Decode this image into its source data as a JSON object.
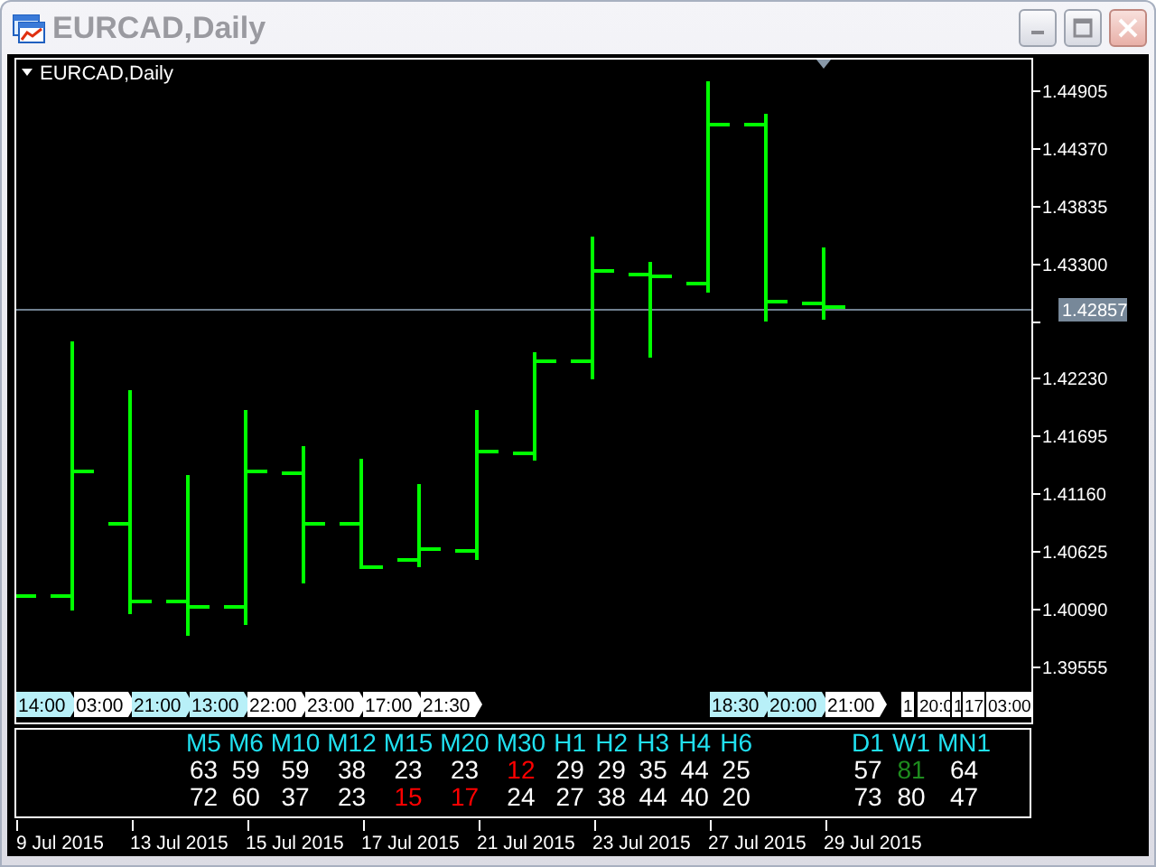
{
  "window": {
    "title": "EURCAD,Daily"
  },
  "chart": {
    "title": "EURCAD,Daily",
    "price_labels": [
      "1.44905",
      "1.44370",
      "1.43835",
      "1.43300",
      "1.42230",
      "1.41695",
      "1.41160",
      "1.40625",
      "1.40090",
      "1.39555"
    ],
    "current_price": "1.42857",
    "time_labels": [
      {
        "text": "14:00",
        "highlighted": true
      },
      {
        "text": "03:00",
        "highlighted": false
      },
      {
        "text": "21:00",
        "highlighted": true
      },
      {
        "text": "13:00",
        "highlighted": true
      },
      {
        "text": "22:00",
        "highlighted": false
      },
      {
        "text": "23:00",
        "highlighted": false
      },
      {
        "text": "17:00",
        "highlighted": false
      },
      {
        "text": "21:30",
        "highlighted": false
      },
      {
        "text": "18:30",
        "highlighted": true
      },
      {
        "text": "20:00",
        "highlighted": true
      },
      {
        "text": "21:00",
        "highlighted": false
      },
      {
        "text": "1",
        "highlighted": false
      },
      {
        "text": "20:0",
        "highlighted": false
      },
      {
        "text": "1",
        "highlighted": false
      },
      {
        "text": "17",
        "highlighted": false
      },
      {
        "text": "03:00",
        "highlighted": false
      }
    ]
  },
  "indicator": {
    "groups": [
      {
        "columns": [
          {
            "label": "M5",
            "values": [
              {
                "text": "63",
                "color": "#ffffff"
              },
              {
                "text": "72",
                "color": "#ffffff"
              }
            ]
          },
          {
            "label": "M6",
            "values": [
              {
                "text": "59",
                "color": "#ffffff"
              },
              {
                "text": "60",
                "color": "#ffffff"
              }
            ]
          },
          {
            "label": "M10",
            "values": [
              {
                "text": "59",
                "color": "#ffffff"
              },
              {
                "text": "37",
                "color": "#ffffff"
              }
            ]
          },
          {
            "label": "M12",
            "values": [
              {
                "text": "38",
                "color": "#ffffff"
              },
              {
                "text": "23",
                "color": "#ffffff"
              }
            ]
          },
          {
            "label": "M15",
            "values": [
              {
                "text": "23",
                "color": "#ffffff"
              },
              {
                "text": "15",
                "color": "#ff0000"
              }
            ]
          },
          {
            "label": "M20",
            "values": [
              {
                "text": "23",
                "color": "#ffffff"
              },
              {
                "text": "17",
                "color": "#ff0000"
              }
            ]
          },
          {
            "label": "M30",
            "values": [
              {
                "text": "12",
                "color": "#ff0000"
              },
              {
                "text": "24",
                "color": "#ffffff"
              }
            ]
          },
          {
            "label": "H1",
            "values": [
              {
                "text": "29",
                "color": "#ffffff"
              },
              {
                "text": "27",
                "color": "#ffffff"
              }
            ]
          },
          {
            "label": "H2",
            "values": [
              {
                "text": "29",
                "color": "#ffffff"
              },
              {
                "text": "38",
                "color": "#ffffff"
              }
            ]
          },
          {
            "label": "H3",
            "values": [
              {
                "text": "35",
                "color": "#ffffff"
              },
              {
                "text": "44",
                "color": "#ffffff"
              }
            ]
          },
          {
            "label": "H4",
            "values": [
              {
                "text": "44",
                "color": "#ffffff"
              },
              {
                "text": "40",
                "color": "#ffffff"
              }
            ]
          },
          {
            "label": "H6",
            "values": [
              {
                "text": "25",
                "color": "#ffffff"
              },
              {
                "text": "20",
                "color": "#ffffff"
              }
            ]
          }
        ]
      },
      {
        "columns": [
          {
            "label": "D1",
            "values": [
              {
                "text": "57",
                "color": "#ffffff"
              },
              {
                "text": "73",
                "color": "#ffffff"
              }
            ]
          },
          {
            "label": "W1",
            "values": [
              {
                "text": "81",
                "color": "#1e8c1e"
              },
              {
                "text": "80",
                "color": "#ffffff"
              }
            ]
          },
          {
            "label": "MN1",
            "values": [
              {
                "text": "64",
                "color": "#ffffff"
              },
              {
                "text": "47",
                "color": "#ffffff"
              }
            ]
          }
        ]
      }
    ]
  },
  "date_axis": [
    "9 Jul 2015",
    "13 Jul 2015",
    "15 Jul 2015",
    "17 Jul 2015",
    "21 Jul 2015",
    "23 Jul 2015",
    "27 Jul 2015",
    "29 Jul 2015"
  ]
}
